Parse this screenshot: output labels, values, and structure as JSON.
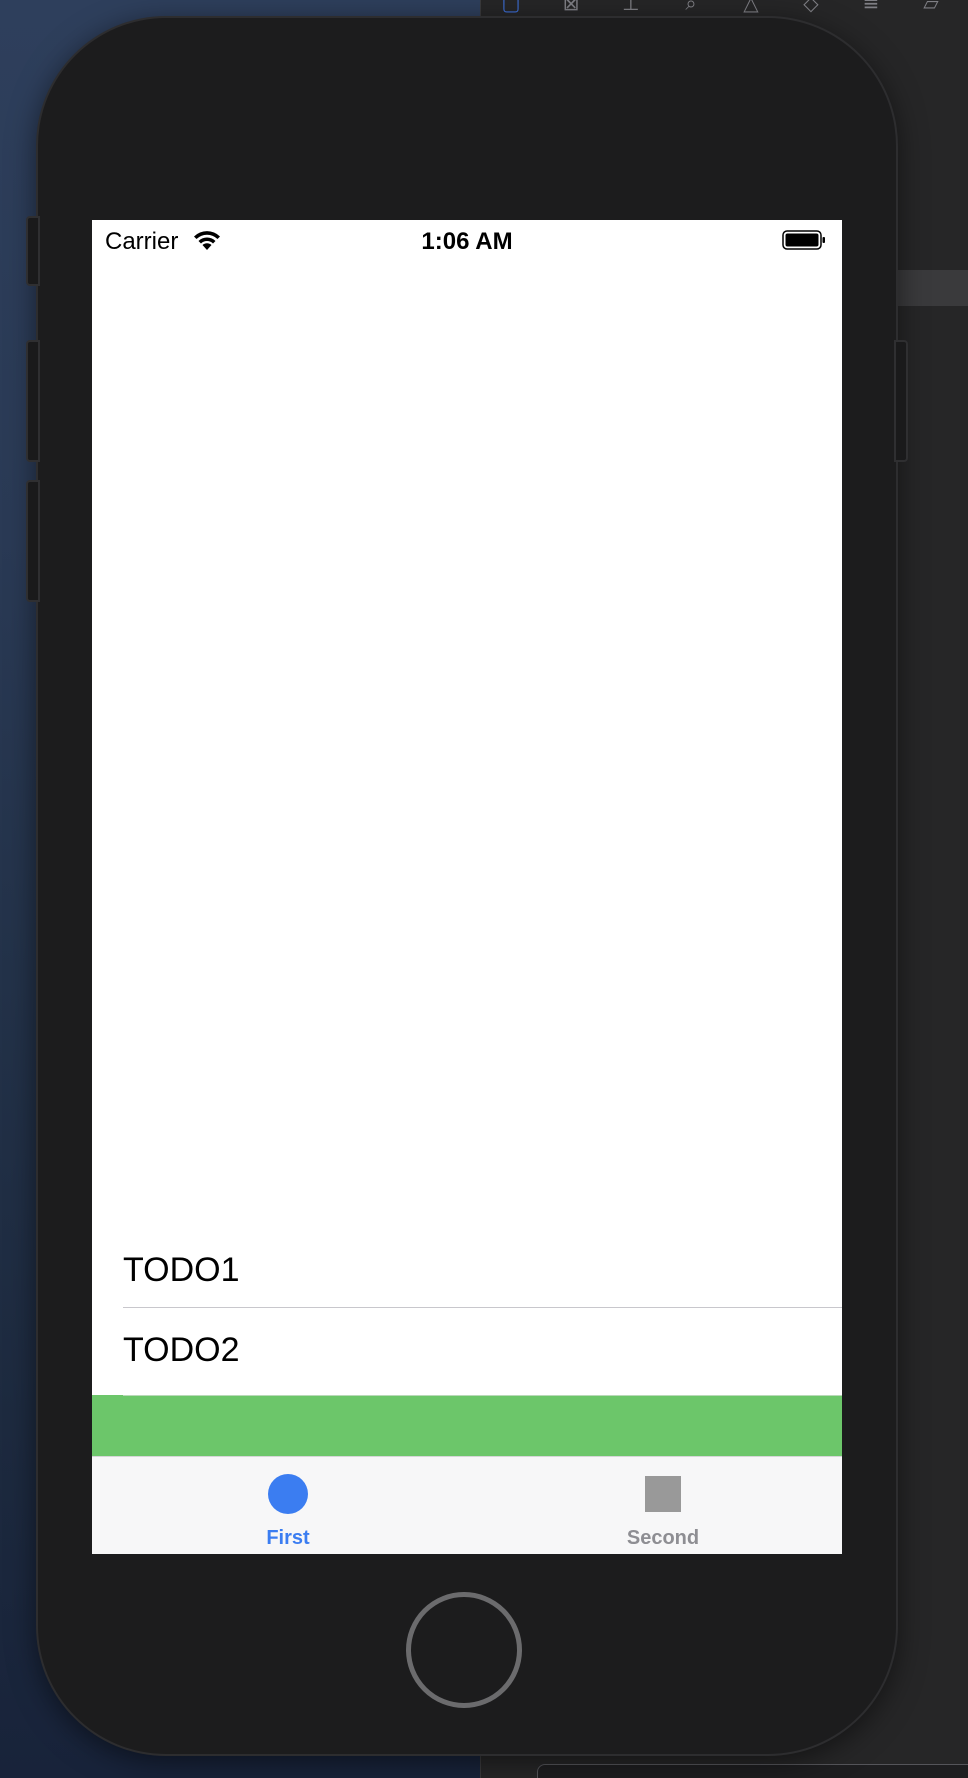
{
  "status_bar": {
    "carrier": "Carrier",
    "time": "1:06 AM",
    "wifi_icon": "wifi-icon",
    "battery_icon": "battery-full-icon"
  },
  "table": {
    "rows": [
      {
        "label": "TODO1"
      },
      {
        "label": "TODO2"
      }
    ],
    "footer_color": "#6cc66a"
  },
  "tab_bar": {
    "tabs": [
      {
        "label": "First",
        "icon": "circle-icon",
        "selected": true,
        "color": "#3b7df1"
      },
      {
        "label": "Second",
        "icon": "square-icon",
        "selected": false,
        "color": "#8e8e93"
      }
    ]
  },
  "device": {
    "home_button_icon": "home-button"
  },
  "xcode_toolbar": {
    "icons": [
      "file-navigator-icon",
      "image-icon",
      "hierarchy-icon",
      "search-icon",
      "warning-icon",
      "breakpoint-icon",
      "list-icon",
      "label-icon"
    ]
  }
}
